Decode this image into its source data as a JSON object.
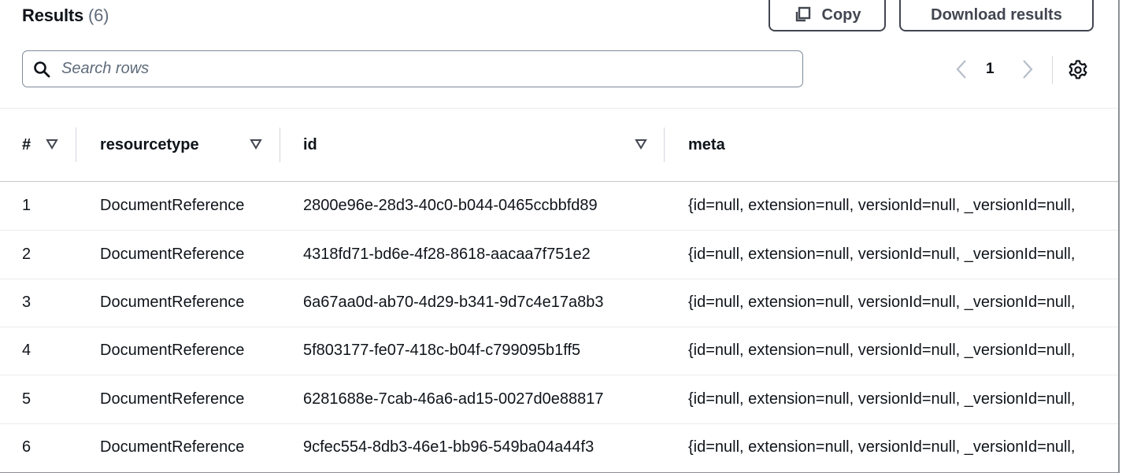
{
  "header": {
    "title": "Results",
    "count": "(6)",
    "copy_label": "Copy",
    "download_label": "Download results"
  },
  "search": {
    "placeholder": "Search rows",
    "value": ""
  },
  "pagination": {
    "current_page": "1"
  },
  "icons": {
    "copy": "copy-icon",
    "search": "search-icon",
    "prev": "chevron-left-icon",
    "next": "chevron-right-icon",
    "settings": "gear-icon",
    "sort": "sort-caret-down-icon"
  },
  "colors": {
    "text": "#0f141a",
    "muted": "#5f6b7a",
    "disabled": "#b6bec9",
    "border": "#7d8998"
  },
  "table": {
    "columns": [
      "#",
      "resourcetype",
      "id",
      "meta"
    ],
    "rows": [
      [
        "1",
        "DocumentReference",
        "2800e96e-28d3-40c0-b044-0465ccbbfd89",
        "{id=null, extension=null, versionId=null, _versionId=null,"
      ],
      [
        "2",
        "DocumentReference",
        "4318fd71-bd6e-4f28-8618-aacaa7f751e2",
        "{id=null, extension=null, versionId=null, _versionId=null,"
      ],
      [
        "3",
        "DocumentReference",
        "6a67aa0d-ab70-4d29-b341-9d7c4e17a8b3",
        "{id=null, extension=null, versionId=null, _versionId=null,"
      ],
      [
        "4",
        "DocumentReference",
        "5f803177-fe07-418c-b04f-c799095b1ff5",
        "{id=null, extension=null, versionId=null, _versionId=null,"
      ],
      [
        "5",
        "DocumentReference",
        "6281688e-7cab-46a6-ad15-0027d0e88817",
        "{id=null, extension=null, versionId=null, _versionId=null,"
      ],
      [
        "6",
        "DocumentReference",
        "9cfec554-8db3-46e1-bb96-549ba04a44f3",
        "{id=null, extension=null, versionId=null, _versionId=null,"
      ]
    ]
  }
}
